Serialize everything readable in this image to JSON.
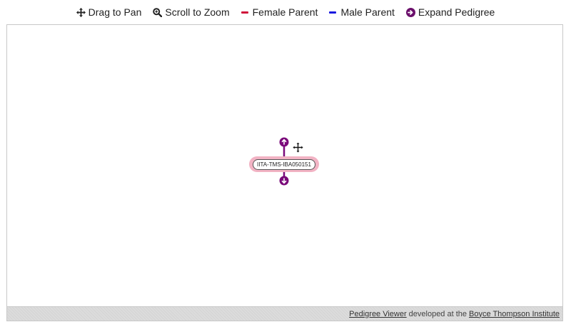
{
  "legend": {
    "pan": {
      "label": "Drag to Pan",
      "icon": "move-arrows-icon"
    },
    "zoom": {
      "label": "Scroll to Zoom",
      "icon": "magnifier-icon"
    },
    "female": {
      "label": "Female Parent",
      "color": "#d0103a"
    },
    "male": {
      "label": "Male Parent",
      "color": "#1a1adf"
    },
    "expand": {
      "label": "Expand Pedigree",
      "icon": "circle-arrow-icon",
      "color": "#6b0f6b"
    }
  },
  "node": {
    "label": "IITA-TMS-IBA050151",
    "highlight_color": "#f2b3c4",
    "connector_color": "#7a0a7a"
  },
  "footer": {
    "viewer_link": "Pedigree Viewer",
    "middle_text": "developed at the",
    "institute_link": "Boyce Thompson Institute"
  }
}
